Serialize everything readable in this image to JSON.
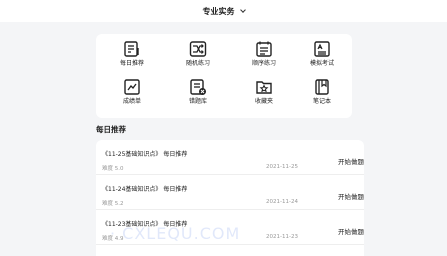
{
  "header": {
    "title": "专业实务"
  },
  "grid": {
    "items": [
      {
        "label": "每日推荐",
        "icon": "daily-recommend-icon"
      },
      {
        "label": "随机练习",
        "icon": "shuffle-practice-icon"
      },
      {
        "label": "顺序练习",
        "icon": "sequential-practice-icon"
      },
      {
        "label": "模拟考试",
        "icon": "mock-exam-icon"
      },
      {
        "label": "成绩单",
        "icon": "transcript-icon"
      },
      {
        "label": "错题库",
        "icon": "wrong-questions-icon"
      },
      {
        "label": "收藏夹",
        "icon": "favorites-icon"
      },
      {
        "label": "笔记本",
        "icon": "notebook-icon"
      }
    ]
  },
  "section": {
    "title": "每日推荐"
  },
  "recommendations": [
    {
      "title": "《11-25基础知识点》 每日推荐",
      "difficulty": "难度 5.0",
      "date": "2021-11-25",
      "action": "开始做题"
    },
    {
      "title": "《11-24基础知识点》 每日推荐",
      "difficulty": "难度 5.2",
      "date": "2021-11-24",
      "action": "开始做题"
    },
    {
      "title": "《11-23基础知识点》 每日推荐",
      "difficulty": "难度 4.9",
      "date": "2021-11-23",
      "action": "开始做题"
    }
  ],
  "watermark": "· CXLEQU.COM",
  "colors": {
    "icon": "#222222",
    "muted": "#999999",
    "background": "#f4f5f7"
  }
}
